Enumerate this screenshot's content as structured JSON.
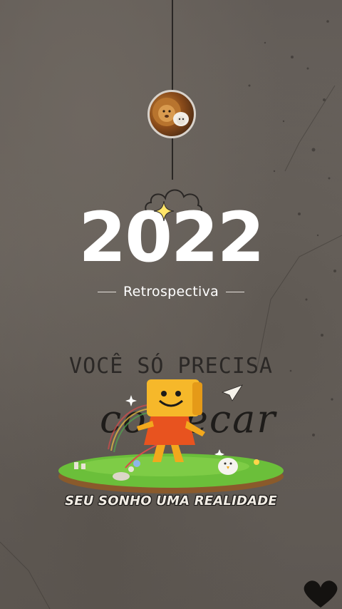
{
  "story": {
    "year": "2022",
    "subtitle": "Retrospectiva",
    "quote_line1": "VOCÊ SÓ PRECISA",
    "quote_line2": "comecar",
    "caption": "SEU SONHO UMA REALIDADE"
  },
  "icons": {
    "avatar": "lion-and-lamb-avatar",
    "sparkle": "sparkle-icon",
    "paper_plane": "paper-plane-icon",
    "heart": "heart-icon"
  },
  "colors": {
    "background": "#625c57",
    "title": "#ffffff",
    "quote": "#2b2826",
    "grass": "#6bbf3a",
    "mascot": "#f2a81d"
  }
}
